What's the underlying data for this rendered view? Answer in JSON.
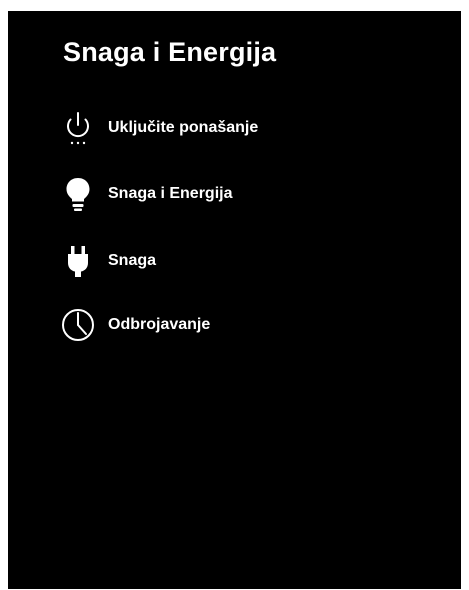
{
  "screen": {
    "title": "Snaga i Energija"
  },
  "menu": {
    "items": [
      {
        "label": "Uključite ponašanje",
        "icon": "power-standby-icon"
      },
      {
        "label": "Snaga i Energija",
        "icon": "lightbulb-icon"
      },
      {
        "label": "Snaga",
        "icon": "power-plug-icon"
      },
      {
        "label": "Odbrojavanje",
        "icon": "clock-icon"
      }
    ]
  },
  "colors": {
    "background": "#000000",
    "text": "#ffffff",
    "frame": "#ffffff"
  }
}
